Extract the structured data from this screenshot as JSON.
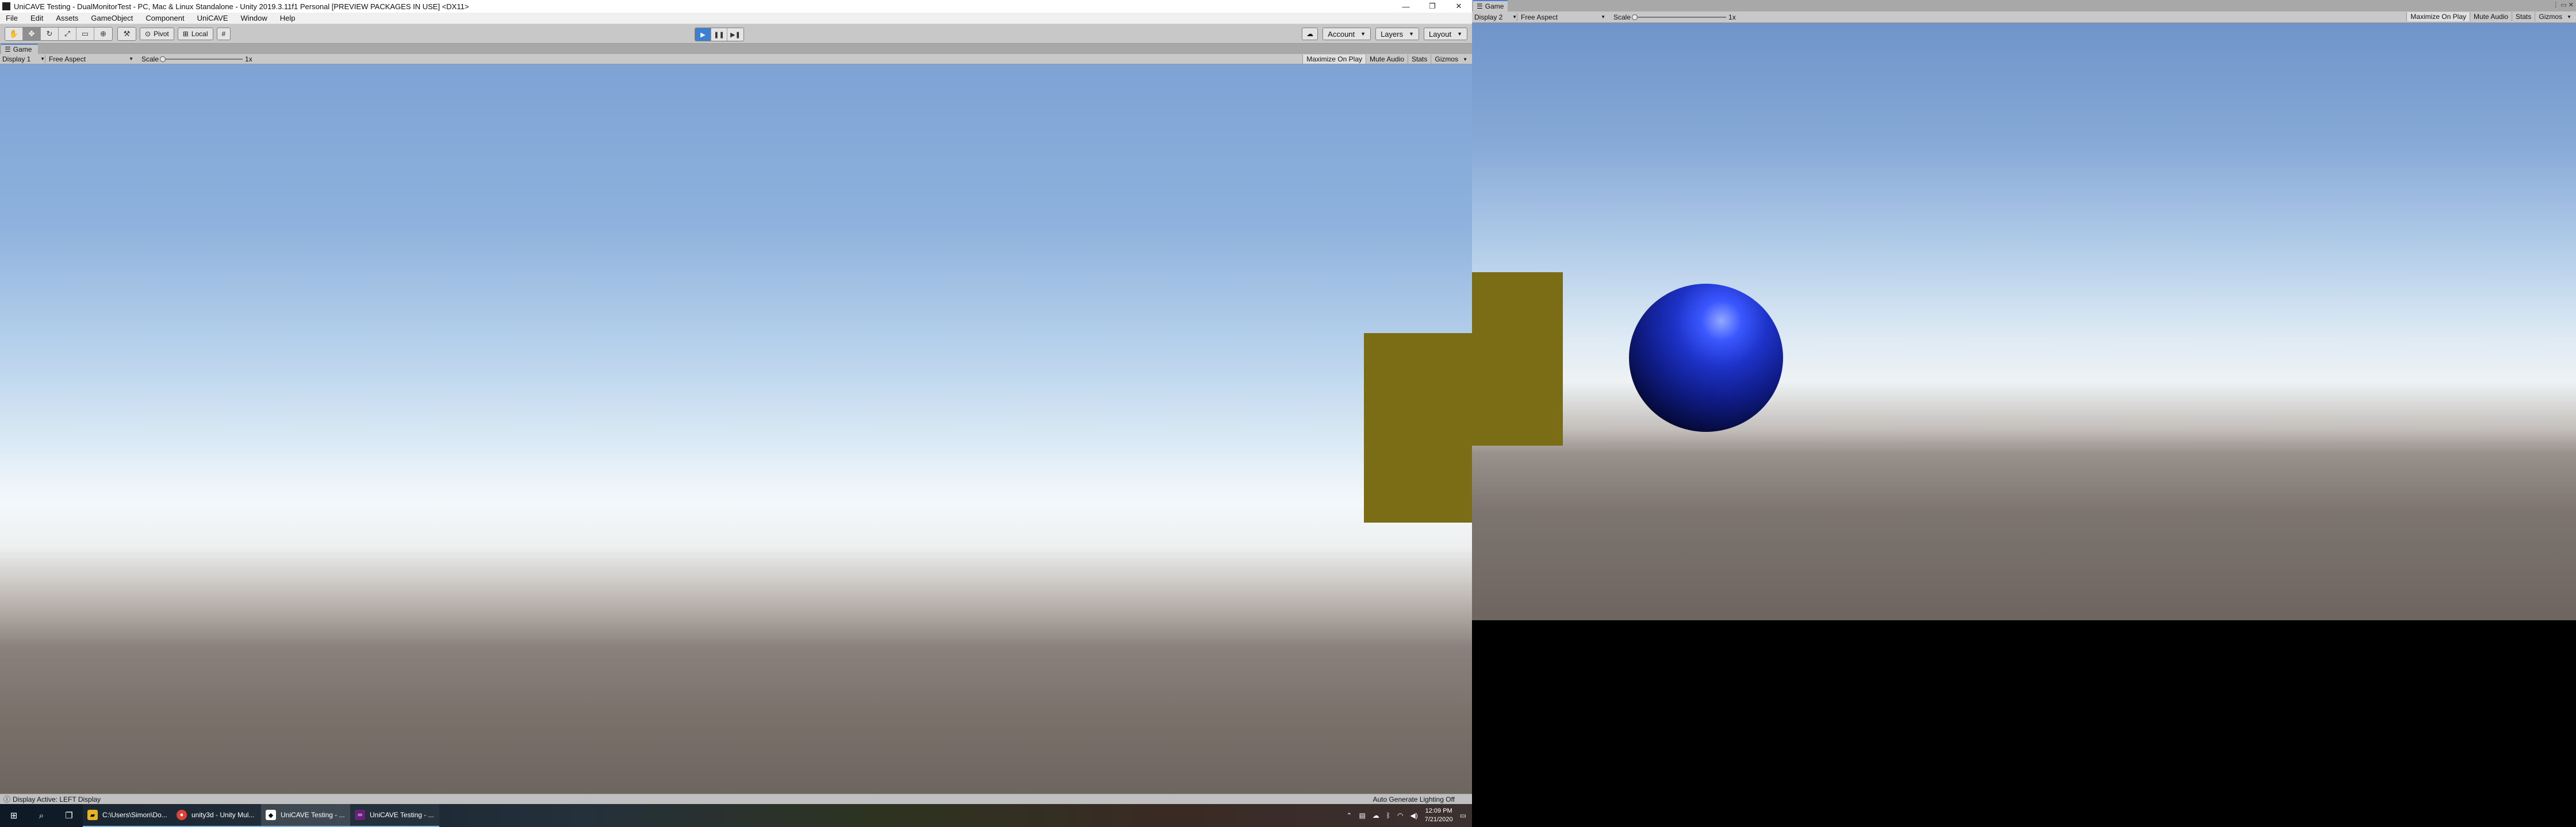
{
  "editor": {
    "title": "UniCAVE Testing - DualMonitorTest - PC, Mac & Linux Standalone - Unity 2019.3.11f1 Personal [PREVIEW PACKAGES IN USE] <DX11>",
    "window_controls": {
      "minimize": "—",
      "maximize": "❐",
      "close": "✕"
    },
    "menu": [
      "File",
      "Edit",
      "Assets",
      "GameObject",
      "Component",
      "UniCAVE",
      "Window",
      "Help"
    ],
    "toolbar": {
      "pivot_label": "Pivot",
      "local_label": "Local",
      "account_label": "Account",
      "layers_label": "Layers",
      "layout_label": "Layout"
    },
    "game_tab": {
      "label": "Game"
    },
    "game_options": {
      "display": "Display 1",
      "aspect": "Free Aspect",
      "scale_label": "Scale",
      "scale_value": "1x",
      "maximize_on_play": "Maximize On Play",
      "mute_audio": "Mute Audio",
      "stats": "Stats",
      "gizmos": "Gizmos"
    },
    "status": {
      "left": "Display Active: LEFT Display",
      "right": "Auto Generate Lighting Off"
    }
  },
  "game_window": {
    "tab_label": "Game",
    "display": "Display 2",
    "aspect": "Free Aspect",
    "scale_label": "Scale",
    "scale_value": "1x",
    "maximize_on_play": "Maximize On Play",
    "mute_audio": "Mute Audio",
    "stats": "Stats",
    "gizmos": "Gizmos"
  },
  "taskbar": {
    "tasks": [
      {
        "label": "C:\\Users\\Simon\\Do...",
        "icon": "folder-icon"
      },
      {
        "label": "unity3d - Unity Mul...",
        "icon": "chrome-icon"
      },
      {
        "label": "UniCAVE Testing - ...",
        "icon": "unity-icon"
      },
      {
        "label": "UniCAVE Testing - ...",
        "icon": "visual-studio-icon"
      }
    ],
    "time": "12:09 PM",
    "date": "7/21/2020"
  },
  "colors": {
    "cube": "#7a6d16",
    "sphere": "#1d32c8",
    "accent": "#3d7fd0"
  }
}
